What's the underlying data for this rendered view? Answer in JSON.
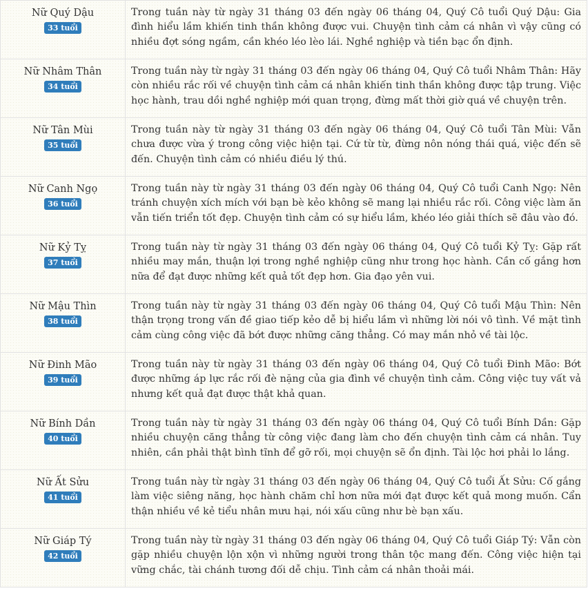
{
  "rows": [
    {
      "name": "Nữ Quý Dậu",
      "age": "33 tuổi",
      "text": "Trong tuần này từ ngày 31 tháng 03 đến ngày 06 tháng 04, Quý Cô tuổi Quý Dậu: Gia đình hiểu lầm khiến tinh thần không được vui. Chuyện tình cảm cá nhân vì vậy cũng có nhiều đợt sóng ngầm, cần khéo léo lèo lái. Nghề nghiệp và tiền bạc ổn định."
    },
    {
      "name": "Nữ Nhâm Thân",
      "age": "34 tuổi",
      "text": "Trong tuần này từ ngày 31 tháng 03 đến ngày 06 tháng 04, Quý Cô tuổi Nhâm Thân: Hãy còn nhiều rắc rối về chuyện tình cảm cá nhân khiến tinh thần không được tập trung. Việc học hành, trau dồi nghề nghiệp mới quan trọng, đừng mất thời giờ quá về chuyện trên."
    },
    {
      "name": "Nữ Tân Mùi",
      "age": "35 tuổi",
      "text": "Trong tuần này từ ngày 31 tháng 03 đến ngày 06 tháng 04, Quý Cô tuổi Tân Mùi: Vẫn chưa được vừa ý trong công việc hiện tại. Cứ từ từ, đừng nôn nóng thái quá, việc đến sẽ đến. Chuyện tình cảm có nhiều điều lý thú."
    },
    {
      "name": "Nữ Canh Ngọ",
      "age": "36 tuổi",
      "text": "Trong tuần này từ ngày 31 tháng 03 đến ngày 06 tháng 04, Quý Cô tuổi Canh Ngọ: Nên tránh chuyện xích mích với bạn bè kẻo không sẽ mang lại nhiều rắc rối. Công việc làm ăn vẫn tiến triển tốt đẹp. Chuyện tình cảm có sự hiểu lầm, khéo léo giải thích sẽ đâu vào đó."
    },
    {
      "name": "Nữ Kỷ Tỵ",
      "age": "37 tuổi",
      "text": "Trong tuần này từ ngày 31 tháng 03 đến ngày 06 tháng 04, Quý Cô tuổi Kỷ Tỵ: Gặp rất nhiều may mắn, thuận lợi trong nghề nghiệp cũng như trong học hành. Cần cố gắng hơn nữa để đạt được những kết quả tốt đẹp hơn. Gia đạo yên vui."
    },
    {
      "name": "Nữ Mậu Thìn",
      "age": "38 tuổi",
      "text": "Trong tuần này từ ngày 31 tháng 03 đến ngày 06 tháng 04, Quý Cô tuổi Mậu Thìn: Nên thận trọng trong vấn đề giao tiếp kẻo dễ bị hiểu lầm vì những lời nói vô tình. Về mặt tình cảm cùng công việc đã bớt được những căng thẳng. Có may mắn nhỏ về tài lộc."
    },
    {
      "name": "Nữ Đinh Mão",
      "age": "39 tuổi",
      "text": "Trong tuần này từ ngày 31 tháng 03 đến ngày 06 tháng 04, Quý Cô tuổi Đinh Mão: Bớt được những áp lực rắc rối đè nặng của gia đình về chuyện tình cảm. Công việc tuy vất vả nhưng kết quả đạt được thật khả quan."
    },
    {
      "name": "Nữ Bính Dần",
      "age": "40 tuổi",
      "text": "Trong tuần này từ ngày 31 tháng 03 đến ngày 06 tháng 04, Quý Cô tuổi Bính Dần: Gặp nhiều chuyện căng thẳng từ công việc đang làm cho đến chuyện tình cảm cá nhân. Tuy nhiên, cần phải thật bình tĩnh để gỡ rối, mọi chuyện sẽ ổn định. Tài lộc hơi phải lo lắng."
    },
    {
      "name": "Nữ Ất Sửu",
      "age": "41 tuổi",
      "text": "Trong tuần này từ ngày 31 tháng 03 đến ngày 06 tháng 04, Quý Cô tuổi Ất Sửu: Cố gắng làm việc siêng năng, học hành chăm chỉ hơn nữa mới đạt được kết quả mong muốn. Cẩn thận nhiều về kẻ tiểu nhân mưu hại, nói xấu cũng như bè bạn xấu."
    },
    {
      "name": "Nữ Giáp Tý",
      "age": "42 tuổi",
      "text": "Trong tuần này từ ngày 31 tháng 03 đến ngày 06 tháng 04, Quý Cô tuổi Giáp Tý: Vẫn còn gặp nhiều chuyện lộn xộn vì những người trong thân tộc mang đến. Công việc hiện tại vững chắc, tài chánh tương đối dễ chịu. Tình cảm cá nhân thoải mái."
    }
  ]
}
